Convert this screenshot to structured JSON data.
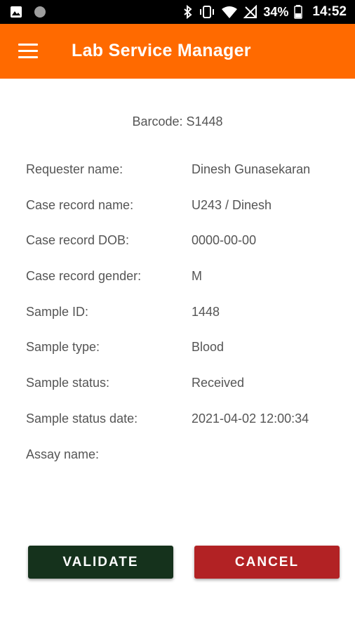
{
  "status_bar": {
    "battery_percent": "34%",
    "time": "14:52",
    "icons": [
      "image-icon",
      "circle-icon",
      "bluetooth-icon",
      "vibrate-icon",
      "wifi-icon",
      "no-signal-icon",
      "battery-icon"
    ]
  },
  "app_bar": {
    "title": "Lab Service Manager",
    "menu_icon": "menu-icon",
    "background_color": "#ff6a00"
  },
  "barcode": {
    "label": "Barcode:",
    "value": "S1448"
  },
  "details": [
    {
      "label": "Requester name:",
      "value": "Dinesh Gunasekaran"
    },
    {
      "label": "Case record name:",
      "value": "U243 / Dinesh"
    },
    {
      "label": "Case record DOB:",
      "value": "0000-00-00"
    },
    {
      "label": "Case record gender:",
      "value": "M"
    },
    {
      "label": "Sample ID:",
      "value": "1448"
    },
    {
      "label": "Sample type:",
      "value": "Blood"
    },
    {
      "label": "Sample status:",
      "value": "Received"
    },
    {
      "label": "Sample status date:",
      "value": "2021-04-02 12:00:34"
    },
    {
      "label": "Assay name:",
      "value": ""
    }
  ],
  "actions": {
    "validate_label": "VALIDATE",
    "validate_color": "#15321c",
    "cancel_label": "CANCEL",
    "cancel_color": "#b22224"
  }
}
